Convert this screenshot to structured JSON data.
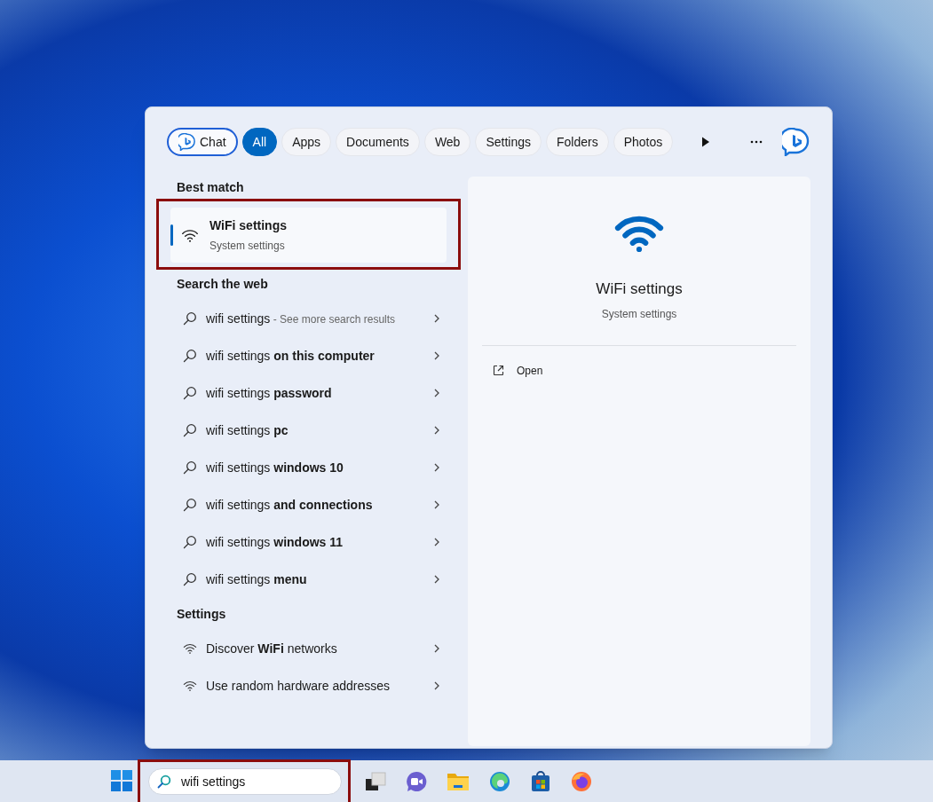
{
  "filters": [
    {
      "label": "Chat",
      "kind": "chat",
      "selected": false
    },
    {
      "label": "All",
      "kind": "pill",
      "selected": true
    },
    {
      "label": "Apps",
      "kind": "pill",
      "selected": false
    },
    {
      "label": "Documents",
      "kind": "pill",
      "selected": false
    },
    {
      "label": "Web",
      "kind": "pill",
      "selected": false
    },
    {
      "label": "Settings",
      "kind": "pill",
      "selected": false
    },
    {
      "label": "Folders",
      "kind": "pill",
      "selected": false
    },
    {
      "label": "Photos",
      "kind": "pill",
      "selected": false
    }
  ],
  "best_match": {
    "heading": "Best match",
    "title": "WiFi settings",
    "subtitle": "System settings",
    "selected": true
  },
  "web": {
    "heading": "Search the web",
    "items": [
      {
        "text": "wifi settings",
        "hint": "- See more search results"
      },
      {
        "text": "wifi settings **on this computer**"
      },
      {
        "text": "wifi settings **password**"
      },
      {
        "text": "wifi settings **pc**"
      },
      {
        "text": "wifi settings **windows 10**"
      },
      {
        "text": "wifi settings **and connections**"
      },
      {
        "text": "wifi settings **windows 11**"
      },
      {
        "text": "wifi settings **menu**"
      }
    ]
  },
  "settings": {
    "heading": "Settings",
    "items": [
      {
        "text": "Discover **WiFi** networks"
      },
      {
        "text": "Use random hardware addresses"
      }
    ]
  },
  "preview": {
    "title": "WiFi settings",
    "subtitle": "System settings",
    "actions": [
      "Open"
    ]
  },
  "taskbar": {
    "search_value": "wifi settings"
  }
}
